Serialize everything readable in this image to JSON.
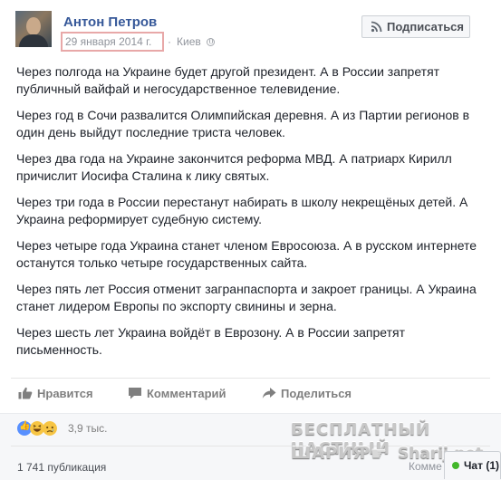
{
  "post": {
    "author": "Антон Петров",
    "date": "29 января 2014 г.",
    "separator": "·",
    "location": "Киев",
    "subscribe_label": "Подписаться",
    "paragraphs": [
      "Через полгода на Украине будет другой президент. А в России запретят публичный вайфай и негосударственное телевидение.",
      "Через год в Сочи развалится Олимпийская деревня. А из Партии регионов в один день выйдут последние триста человек.",
      "Через два года на Украине закончится реформа МВД. А патриарх Кирилл причислит Иосифа Сталина к лику святых.",
      "Через три года в России перестанут набирать в школу некрещёных детей. А Украина реформирует судебную систему.",
      "Через четыре года Украина станет членом Евросоюза. А в русском интернете останутся только четыре государственных сайта.",
      "Через пять лет Россия отменит загранпаспорта и закроет границы. А Украина станет лидером Европы по экспорту свинины и зерна.",
      "Через шесть лет Украина войдёт в Еврозону. А в России запретят письменность."
    ]
  },
  "actions": {
    "like": "Нравится",
    "comment": "Комментарий",
    "share": "Поделиться"
  },
  "reactions": {
    "count": "3,9 тыс.",
    "types": [
      "like",
      "haha",
      "sad"
    ]
  },
  "shares": "1 741 публикация",
  "watermark": {
    "line1": "БЕСПЛАТНЫЙ ЧАСТНЫЙ",
    "line2": "ШАРИЯ",
    "site": "Sharij.net"
  },
  "comment_partial": "Комме",
  "chat": {
    "label": "Чат (1)",
    "status_color": "#42b72a"
  },
  "colors": {
    "author_link": "#365899",
    "meta_gray": "#90949c",
    "date_highlight_border": "#e8a8a8"
  }
}
